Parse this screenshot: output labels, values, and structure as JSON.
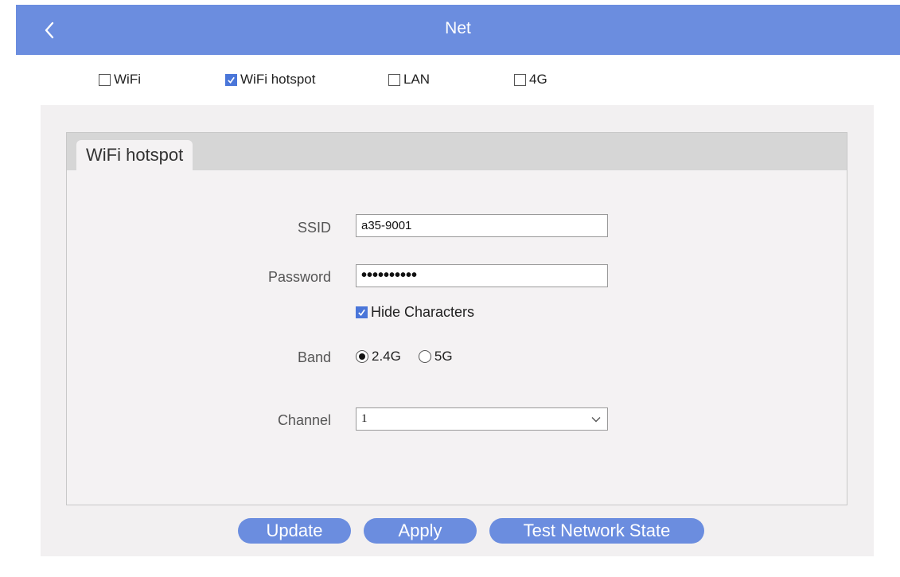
{
  "header": {
    "title": "Net",
    "back_icon": "chevron-left-icon"
  },
  "net_types": [
    {
      "label": "WiFi",
      "checked": false
    },
    {
      "label": "WiFi hotspot",
      "checked": true
    },
    {
      "label": "LAN",
      "checked": false
    },
    {
      "label": "4G",
      "checked": false
    }
  ],
  "panel": {
    "tab_label": "WiFi hotspot",
    "ssid": {
      "label": "SSID",
      "value": "a35-9001"
    },
    "password": {
      "label": "Password",
      "value": "••••••••••"
    },
    "hide_characters": {
      "label": "Hide Characters",
      "checked": true
    },
    "band": {
      "label": "Band",
      "options": [
        {
          "label": "2.4G",
          "selected": true
        },
        {
          "label": "5G",
          "selected": false
        }
      ]
    },
    "channel": {
      "label": "Channel",
      "value": "1"
    }
  },
  "buttons": {
    "update": "Update",
    "apply": "Apply",
    "test": "Test Network State"
  },
  "colors": {
    "accent": "#6b8ddf",
    "checkbox_checked": "#4a76d9",
    "panel_bg": "#f2f0f1",
    "tab_strip": "#d6d6d6"
  }
}
